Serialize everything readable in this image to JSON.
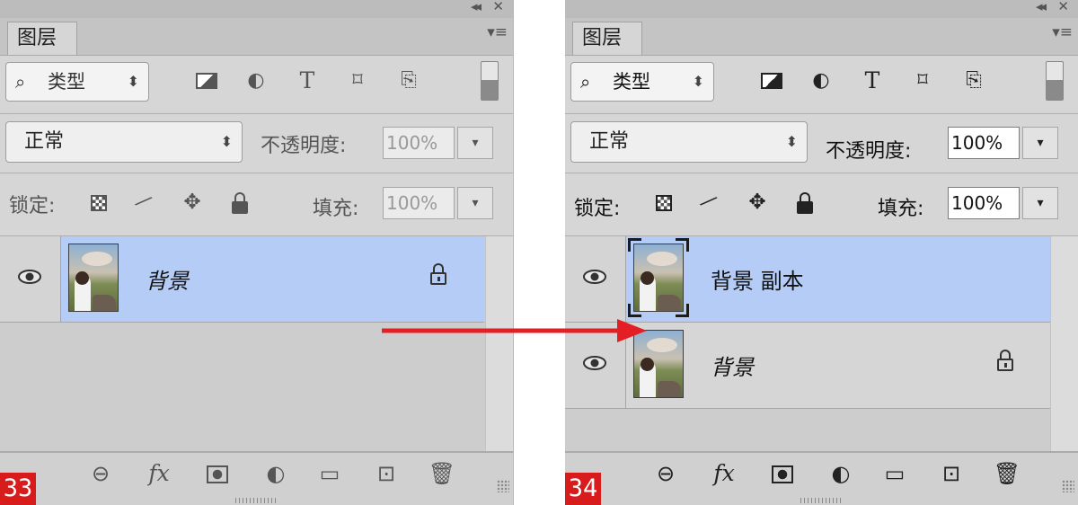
{
  "panels": [
    {
      "badge": "33",
      "tab": "图层",
      "filter": {
        "glass": "⌕",
        "label": "类型",
        "arrow": "⬍"
      },
      "blend": {
        "value": "正常",
        "arrow": "⬍"
      },
      "opacity": {
        "label": "不透明度:",
        "value": "100%",
        "active": false
      },
      "lock_label": "锁定:",
      "fill": {
        "label": "填充:",
        "value": "100%",
        "active": false
      },
      "layers": [
        {
          "name": "背景",
          "italic": true,
          "selected": true,
          "locked": true
        }
      ]
    },
    {
      "badge": "34",
      "tab": "图层",
      "filter": {
        "glass": "⌕",
        "label": "类型",
        "arrow": "⬍"
      },
      "blend": {
        "value": "正常",
        "arrow": "⬍"
      },
      "opacity": {
        "label": "不透明度:",
        "value": "100%",
        "active": true
      },
      "lock_label": "锁定:",
      "fill": {
        "label": "填充:",
        "value": "100%",
        "active": true
      },
      "layers": [
        {
          "name": "背景 副本",
          "italic": false,
          "selected": true,
          "locked": false
        },
        {
          "name": "背景",
          "italic": true,
          "selected": false,
          "locked": true
        }
      ]
    }
  ],
  "icons": {
    "collapse": "◂◂",
    "close": "✕",
    "panel_menu": "▾≡",
    "spin": "▾",
    "adjust_filter": "◐",
    "type_filter": "T",
    "shape_filter": "⌑",
    "smart_filter": "⎘",
    "brush": "⁄",
    "move": "✥",
    "link": "⊖",
    "fx": "fx",
    "adjustment": "◐",
    "folder": "▭",
    "new_layer": "⊡",
    "trash": "🗑"
  },
  "colors": {
    "selected_row": "#b5cdf6",
    "badge": "#d81b1b",
    "arrow": "#e31e24"
  }
}
